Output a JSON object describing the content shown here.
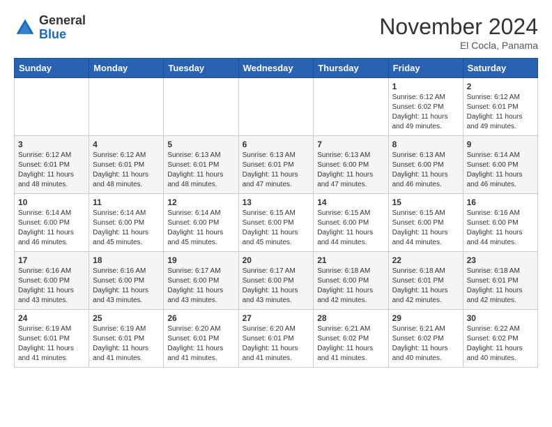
{
  "logo": {
    "general": "General",
    "blue": "Blue"
  },
  "title": "November 2024",
  "location": "El Cocla, Panama",
  "days_of_week": [
    "Sunday",
    "Monday",
    "Tuesday",
    "Wednesday",
    "Thursday",
    "Friday",
    "Saturday"
  ],
  "weeks": [
    [
      {
        "day": "",
        "info": ""
      },
      {
        "day": "",
        "info": ""
      },
      {
        "day": "",
        "info": ""
      },
      {
        "day": "",
        "info": ""
      },
      {
        "day": "",
        "info": ""
      },
      {
        "day": "1",
        "info": "Sunrise: 6:12 AM\nSunset: 6:02 PM\nDaylight: 11 hours and 49 minutes."
      },
      {
        "day": "2",
        "info": "Sunrise: 6:12 AM\nSunset: 6:01 PM\nDaylight: 11 hours and 49 minutes."
      }
    ],
    [
      {
        "day": "3",
        "info": "Sunrise: 6:12 AM\nSunset: 6:01 PM\nDaylight: 11 hours and 48 minutes."
      },
      {
        "day": "4",
        "info": "Sunrise: 6:12 AM\nSunset: 6:01 PM\nDaylight: 11 hours and 48 minutes."
      },
      {
        "day": "5",
        "info": "Sunrise: 6:13 AM\nSunset: 6:01 PM\nDaylight: 11 hours and 48 minutes."
      },
      {
        "day": "6",
        "info": "Sunrise: 6:13 AM\nSunset: 6:01 PM\nDaylight: 11 hours and 47 minutes."
      },
      {
        "day": "7",
        "info": "Sunrise: 6:13 AM\nSunset: 6:00 PM\nDaylight: 11 hours and 47 minutes."
      },
      {
        "day": "8",
        "info": "Sunrise: 6:13 AM\nSunset: 6:00 PM\nDaylight: 11 hours and 46 minutes."
      },
      {
        "day": "9",
        "info": "Sunrise: 6:14 AM\nSunset: 6:00 PM\nDaylight: 11 hours and 46 minutes."
      }
    ],
    [
      {
        "day": "10",
        "info": "Sunrise: 6:14 AM\nSunset: 6:00 PM\nDaylight: 11 hours and 46 minutes."
      },
      {
        "day": "11",
        "info": "Sunrise: 6:14 AM\nSunset: 6:00 PM\nDaylight: 11 hours and 45 minutes."
      },
      {
        "day": "12",
        "info": "Sunrise: 6:14 AM\nSunset: 6:00 PM\nDaylight: 11 hours and 45 minutes."
      },
      {
        "day": "13",
        "info": "Sunrise: 6:15 AM\nSunset: 6:00 PM\nDaylight: 11 hours and 45 minutes."
      },
      {
        "day": "14",
        "info": "Sunrise: 6:15 AM\nSunset: 6:00 PM\nDaylight: 11 hours and 44 minutes."
      },
      {
        "day": "15",
        "info": "Sunrise: 6:15 AM\nSunset: 6:00 PM\nDaylight: 11 hours and 44 minutes."
      },
      {
        "day": "16",
        "info": "Sunrise: 6:16 AM\nSunset: 6:00 PM\nDaylight: 11 hours and 44 minutes."
      }
    ],
    [
      {
        "day": "17",
        "info": "Sunrise: 6:16 AM\nSunset: 6:00 PM\nDaylight: 11 hours and 43 minutes."
      },
      {
        "day": "18",
        "info": "Sunrise: 6:16 AM\nSunset: 6:00 PM\nDaylight: 11 hours and 43 minutes."
      },
      {
        "day": "19",
        "info": "Sunrise: 6:17 AM\nSunset: 6:00 PM\nDaylight: 11 hours and 43 minutes."
      },
      {
        "day": "20",
        "info": "Sunrise: 6:17 AM\nSunset: 6:00 PM\nDaylight: 11 hours and 43 minutes."
      },
      {
        "day": "21",
        "info": "Sunrise: 6:18 AM\nSunset: 6:00 PM\nDaylight: 11 hours and 42 minutes."
      },
      {
        "day": "22",
        "info": "Sunrise: 6:18 AM\nSunset: 6:01 PM\nDaylight: 11 hours and 42 minutes."
      },
      {
        "day": "23",
        "info": "Sunrise: 6:18 AM\nSunset: 6:01 PM\nDaylight: 11 hours and 42 minutes."
      }
    ],
    [
      {
        "day": "24",
        "info": "Sunrise: 6:19 AM\nSunset: 6:01 PM\nDaylight: 11 hours and 41 minutes."
      },
      {
        "day": "25",
        "info": "Sunrise: 6:19 AM\nSunset: 6:01 PM\nDaylight: 11 hours and 41 minutes."
      },
      {
        "day": "26",
        "info": "Sunrise: 6:20 AM\nSunset: 6:01 PM\nDaylight: 11 hours and 41 minutes."
      },
      {
        "day": "27",
        "info": "Sunrise: 6:20 AM\nSunset: 6:01 PM\nDaylight: 11 hours and 41 minutes."
      },
      {
        "day": "28",
        "info": "Sunrise: 6:21 AM\nSunset: 6:02 PM\nDaylight: 11 hours and 41 minutes."
      },
      {
        "day": "29",
        "info": "Sunrise: 6:21 AM\nSunset: 6:02 PM\nDaylight: 11 hours and 40 minutes."
      },
      {
        "day": "30",
        "info": "Sunrise: 6:22 AM\nSunset: 6:02 PM\nDaylight: 11 hours and 40 minutes."
      }
    ]
  ]
}
